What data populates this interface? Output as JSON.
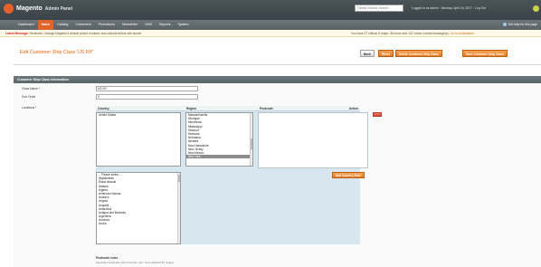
{
  "header": {
    "logo_text": "Magento",
    "logo_sub": "Admin Panel",
    "search_placeholder": "Global Record Search",
    "meta": "Logged in as admin · Monday, April 16, 2017 · Log Out"
  },
  "nav": {
    "items": [
      "Dashboard",
      "Sales",
      "Catalog",
      "Customers",
      "Promotions",
      "Newsletter",
      "CMS",
      "Reports",
      "System"
    ],
    "active_index": 1,
    "right_label": "Get help for this page"
  },
  "message": {
    "left_bold": "Latest Message:",
    "left_text": "Reminder: Change Magento's default phone numbers and callouts before site launch",
    "right_text": "You have 27 critical, 8 major, 38 minor and 147 notice unread message(s).",
    "right_link": "Go to notifications"
  },
  "page": {
    "title": "Edit Customer Ship Class 'US NY'",
    "buttons": {
      "back": "Back",
      "reset": "Reset",
      "delete": "Delete Customer Ship Class",
      "save": "Save Customer Ship Class"
    }
  },
  "section": {
    "title": "Customer Ship Class Information"
  },
  "form": {
    "class_name_label": "Class Name *",
    "class_name_value": "US NY",
    "sort_order_label": "Sort Order",
    "sort_order_value": "0",
    "locations_label": "Locations *",
    "columns": {
      "country": "Country",
      "region": "Region",
      "postcode": "Postcode",
      "action": "Action"
    },
    "country_selected": "United States",
    "regions": [
      "Massachusetts",
      "Michigan",
      "Minnesota",
      "Mississippi",
      "Missouri",
      "Montana",
      "Nebraska",
      "Nevada",
      "New Hampshire",
      "New Jersey",
      "New Mexico",
      "New York"
    ],
    "region_selected_index": 11,
    "country_list": [
      "-- Please select --",
      "Afghanistan",
      "Åland Islands",
      "Albania",
      "Algeria",
      "American Samoa",
      "Andorra",
      "Angola",
      "Anguilla",
      "Antarctica",
      "Antigua and Barbuda",
      "Argentina",
      "Armenia",
      "Aruba"
    ],
    "add_button": "Add Country Zone",
    "note_title": "Postcode rules",
    "note_text": "Separate postcodes with commas; use * as a wildcard for ranges."
  },
  "colors": {
    "accent": "#e87a1e",
    "header": "#3a4247",
    "nav": "#596166",
    "zone_bg": "#d8e6ef"
  }
}
